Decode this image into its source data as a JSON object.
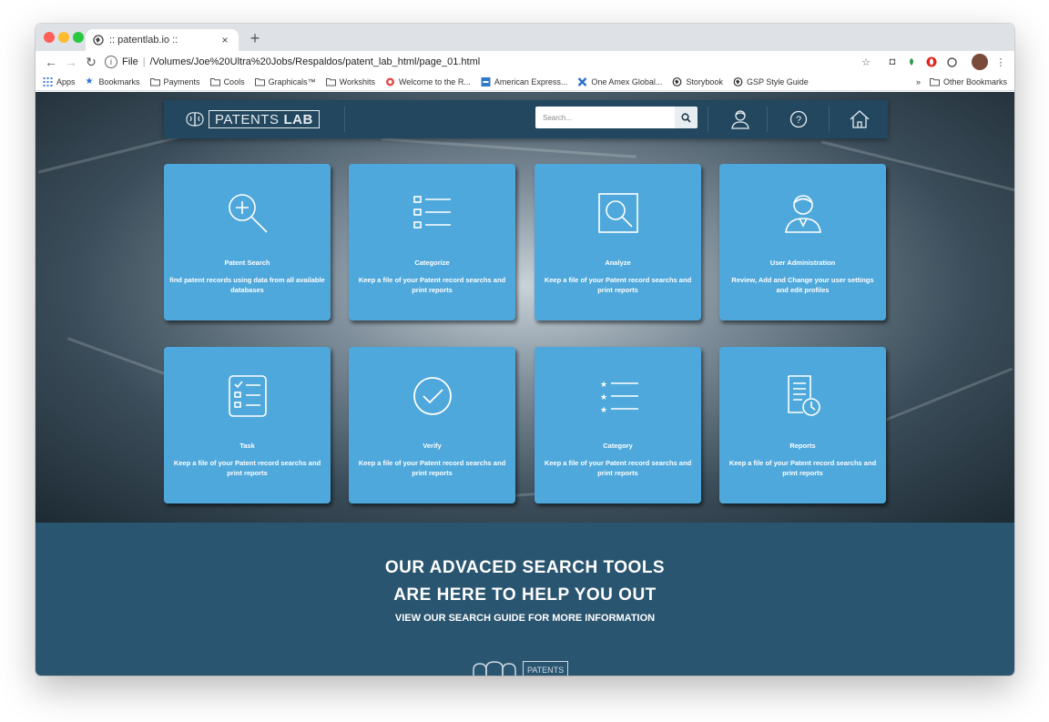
{
  "browser": {
    "tab_title": ":: patentlab.io ::",
    "tab_close": "×",
    "new_tab": "+",
    "url_prefix": "File",
    "url": "/Volumes/Joe%20Ultra%20Jobs/Respaldos/patent_lab_html/page_01.html",
    "bookmarks": [
      {
        "label": "Apps",
        "icon": "apps-grid-icon"
      },
      {
        "label": "Bookmarks",
        "icon": "star-icon"
      },
      {
        "label": "Payments",
        "icon": "folder-icon"
      },
      {
        "label": "Cools",
        "icon": "folder-icon"
      },
      {
        "label": "Graphicals™",
        "icon": "folder-icon"
      },
      {
        "label": "Workshits",
        "icon": "folder-icon"
      },
      {
        "label": "Welcome to the R...",
        "icon": "red-circle-icon"
      },
      {
        "label": "American Express...",
        "icon": "amex-icon"
      },
      {
        "label": "One Amex Global...",
        "icon": "cross-icon"
      },
      {
        "label": "Storybook",
        "icon": "globe-icon"
      },
      {
        "label": "GSP Style Guide",
        "icon": "globe-icon"
      }
    ],
    "overflow": "»",
    "other_bookmarks": "Other Bookmarks"
  },
  "header": {
    "logo_text": "PATENTS",
    "logo_bold": "LAB",
    "search_placeholder": "Search..."
  },
  "cards": [
    {
      "title": "Patent Search",
      "desc": "find patent records using data from all available databases",
      "icon": "magnify-plus-icon"
    },
    {
      "title": "Categorize",
      "desc": "Keep a file of your Patent record searchs and print reports",
      "icon": "list-icon"
    },
    {
      "title": "Analyze",
      "desc": "Keep a file of your Patent record searchs and print reports",
      "icon": "magnify-box-icon"
    },
    {
      "title": "User Administration",
      "desc": "Review, Add and Change your user settings and edit profiles",
      "icon": "user-icon"
    },
    {
      "title": "Task",
      "desc": "Keep a file of your Patent record searchs and print reports",
      "icon": "checklist-icon"
    },
    {
      "title": "Verify",
      "desc": "Keep a file of your Patent record searchs and print reports",
      "icon": "check-circle-icon"
    },
    {
      "title": "Category",
      "desc": "Keep a file of your Patent record searchs and print reports",
      "icon": "star-list-icon"
    },
    {
      "title": "Reports",
      "desc": "Keep a file of your Patent record searchs and print reports",
      "icon": "report-clock-icon"
    }
  ],
  "footer": {
    "headline_1": "OUR ADVACED SEARCH TOOLS",
    "headline_2": "ARE HERE TO HELP YOU OUT",
    "subline": "VIEW OUR SEARCH GUIDE FOR MORE INFORMATION",
    "logo_text": "PATENTS"
  },
  "colors": {
    "card": "#4fa8db",
    "navbar": "#22475e",
    "footer": "#2a5570"
  }
}
